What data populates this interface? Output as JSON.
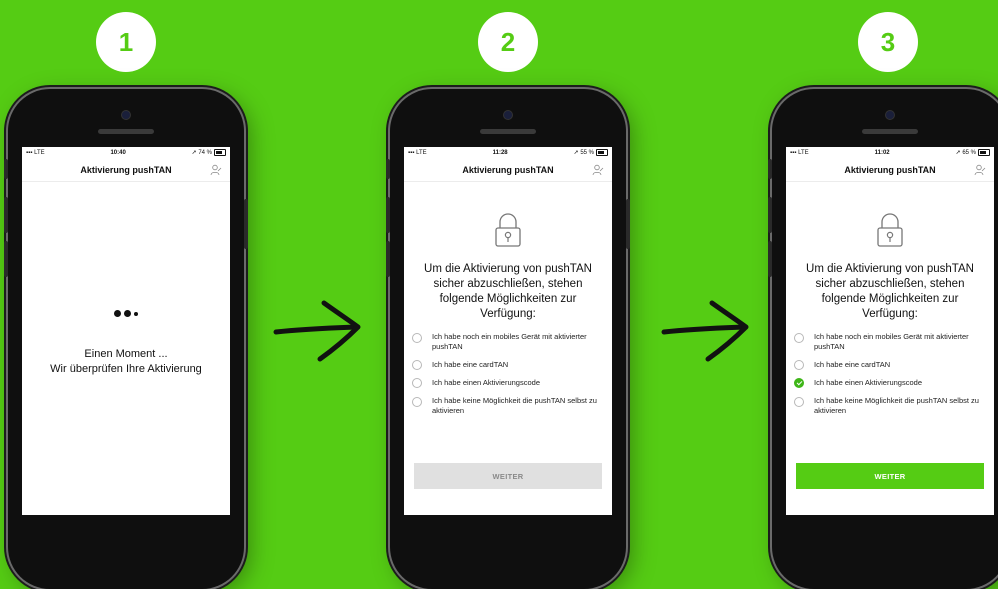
{
  "steps": [
    "1",
    "2",
    "3"
  ],
  "phone1": {
    "status": {
      "signal": "LTE",
      "time": "10:40",
      "battery": "74 %"
    },
    "title": "Aktivierung pushTAN",
    "loading_line1": "Einen Moment ...",
    "loading_line2": "Wir überprüfen Ihre Aktivierung"
  },
  "phone2": {
    "status": {
      "signal": "LTE",
      "time": "11:28",
      "battery": "55 %"
    },
    "title": "Aktivierung pushTAN",
    "intro": "Um die Aktivierung von pushTAN sicher abzuschließen, stehen folgende Möglichkeiten zur Verfügung:",
    "options": [
      "Ich habe noch ein mobiles Gerät mit aktivierter pushTAN",
      "Ich habe eine cardTAN",
      "Ich habe einen Aktivierungscode",
      "Ich habe keine Möglichkeit die pushTAN selbst zu aktivieren"
    ],
    "selected_option": null,
    "button": "WEITER",
    "button_enabled": false
  },
  "phone3": {
    "status": {
      "signal": "LTE",
      "time": "11:02",
      "battery": "65 %"
    },
    "title": "Aktivierung pushTAN",
    "intro": "Um die Aktivierung von pushTAN sicher abzuschließen, stehen folgende Möglichkeiten zur Verfügung:",
    "options": [
      "Ich habe noch ein mobiles Gerät mit aktivierter pushTAN",
      "Ich habe eine cardTAN",
      "Ich habe einen Aktivierungscode",
      "Ich habe keine Möglichkeit die pushTAN selbst zu aktivieren"
    ],
    "selected_option": 2,
    "button": "WEITER",
    "button_enabled": true
  },
  "colors": {
    "background": "#55cc14",
    "accent": "#3fb618",
    "button_disabled": "#e0e0e0"
  },
  "icons": {
    "lock": "lock-icon",
    "user": "user-edit-icon",
    "arrow": "arrow-right-icon",
    "loading": "loading-dots-icon"
  }
}
